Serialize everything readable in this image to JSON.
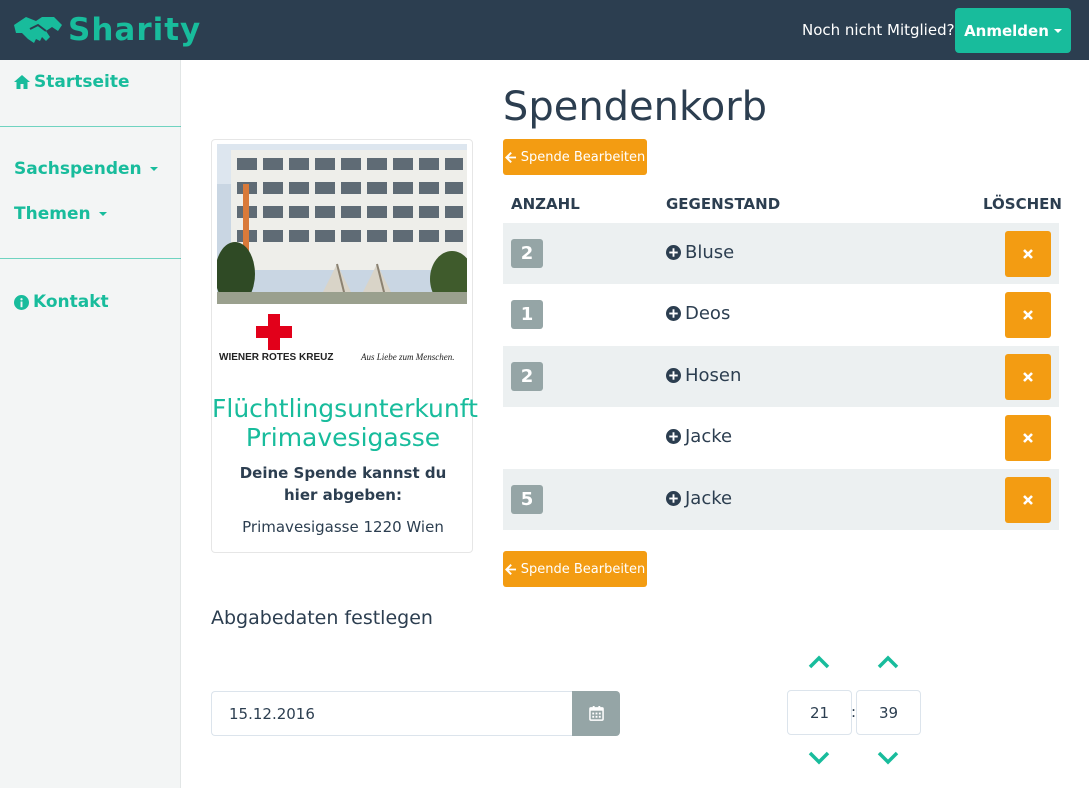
{
  "navbar": {
    "brand": "Sharity",
    "not_member": "Noch nicht Mitglied?",
    "login_label": "Anmelden"
  },
  "sidebar": {
    "home": "Startseite",
    "donations": "Sachspenden",
    "topics": "Themen",
    "contact": "Kontakt"
  },
  "main": {
    "title": "Spendenkorb",
    "edit_label": "Spende Bearbeiten",
    "table": {
      "headers": [
        "ANZAHL",
        "GEGENSTAND",
        "LÖSCHEN"
      ],
      "rows": [
        {
          "qty": "2",
          "item": "Bluse"
        },
        {
          "qty": "1",
          "item": "Deos"
        },
        {
          "qty": "2",
          "item": "Hosen"
        },
        {
          "qty": "",
          "item": "Jacke"
        },
        {
          "qty": "5",
          "item": "Jacke"
        }
      ]
    },
    "card": {
      "logo_text": "WIENER ROTES KREUZ",
      "logo_slogan": "Aus Liebe zum Menschen.",
      "name": "Flüchtlingsunterkunft Primavesigasse",
      "label": "Deine Spende kannst du hier abgeben:",
      "address": "Primavesigasse 1220 Wien"
    },
    "dropoff": {
      "title": "Abgabedaten festlegen",
      "date": "15.12.2016",
      "hour": "21",
      "minute": "39",
      "separator": ":"
    }
  },
  "colors": {
    "navbar": "#2c3e50",
    "accent": "#18bc9c",
    "warning": "#f39c12",
    "badge": "#95a5a6"
  }
}
